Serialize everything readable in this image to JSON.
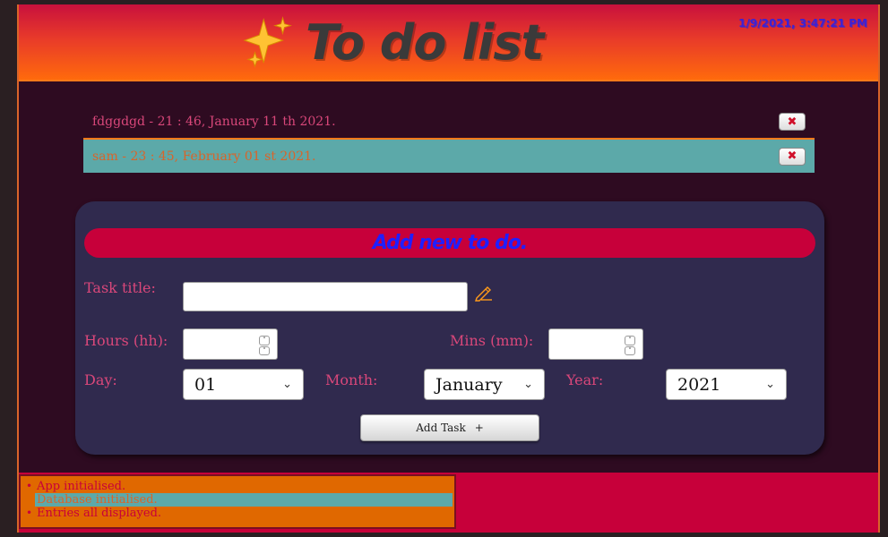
{
  "header": {
    "title": "To do list",
    "clock": "1/9/2021, 3:47:21 PM",
    "icon": "sparkles-icon",
    "colors": {
      "gradient_top": "#c8103d",
      "gradient_bottom": "#ff6a0c",
      "title": "#3a3a3a",
      "clock": "#3b21d6"
    }
  },
  "todos": [
    {
      "text": "fdggdgd - 21 : 46, January 11 th 2021.",
      "delete_label": "✖"
    },
    {
      "text": "sam - 23 : 45, February 01 st 2021.",
      "delete_label": "✖"
    }
  ],
  "form": {
    "heading": "Add new to do.",
    "task_title_label": "Task title:",
    "task_title_value": "",
    "hours_label": "Hours (hh):",
    "hours_value": "",
    "mins_label": "Mins (mm):",
    "mins_value": "",
    "day_label": "Day:",
    "day_value": "01",
    "month_label": "Month:",
    "month_value": "January",
    "year_label": "Year:",
    "year_value": "2021",
    "add_button_label": "Add Task",
    "add_button_icon": "+",
    "pencil_icon": "pencil-icon",
    "colors": {
      "panel": "#302a4e",
      "heading_bar": "#c7003a",
      "heading_text": "#1f1fff",
      "label": "#d9477a"
    }
  },
  "log": {
    "entries": [
      "App initialised.",
      "Database initialised.",
      "Entries all displayed."
    ],
    "colors": {
      "box": "#e06800",
      "text": "#c7003a",
      "highlight": "#5ca9a9"
    }
  }
}
